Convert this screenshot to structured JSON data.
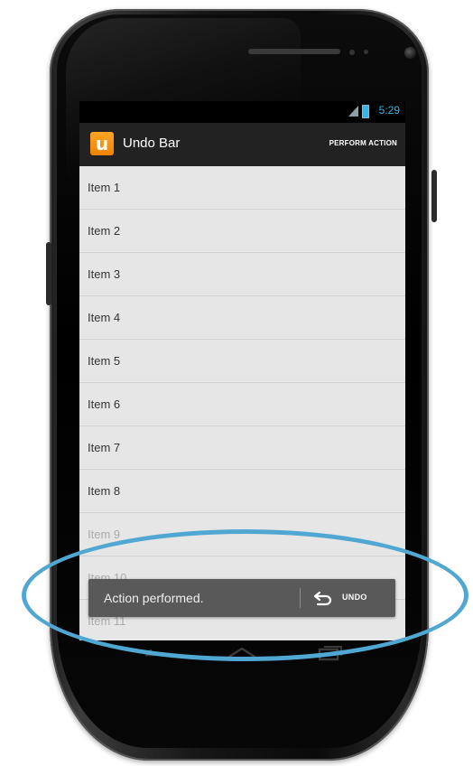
{
  "status_bar": {
    "time": "5:29"
  },
  "action_bar": {
    "app_icon_letter": "u",
    "title": "Undo Bar",
    "perform_action": "PERFORM ACTION"
  },
  "list": {
    "items": [
      "Item 1",
      "Item 2",
      "Item 3",
      "Item 4",
      "Item 5",
      "Item 6",
      "Item 7",
      "Item 8",
      "Item 9",
      "Item 10",
      "Item 11"
    ]
  },
  "undo_bar": {
    "message": "Action performed.",
    "undo_label": "UNDO"
  },
  "colors": {
    "accent_holo_blue": "#33b5e5",
    "app_icon_orange": "#f08300",
    "action_bar": "#222222",
    "undo_bar": "#555555",
    "highlight_ellipse": "#50a8d2"
  },
  "icons": [
    "signal-icon",
    "battery-icon",
    "undo-icon",
    "back-icon",
    "home-icon",
    "recent-apps-icon"
  ]
}
